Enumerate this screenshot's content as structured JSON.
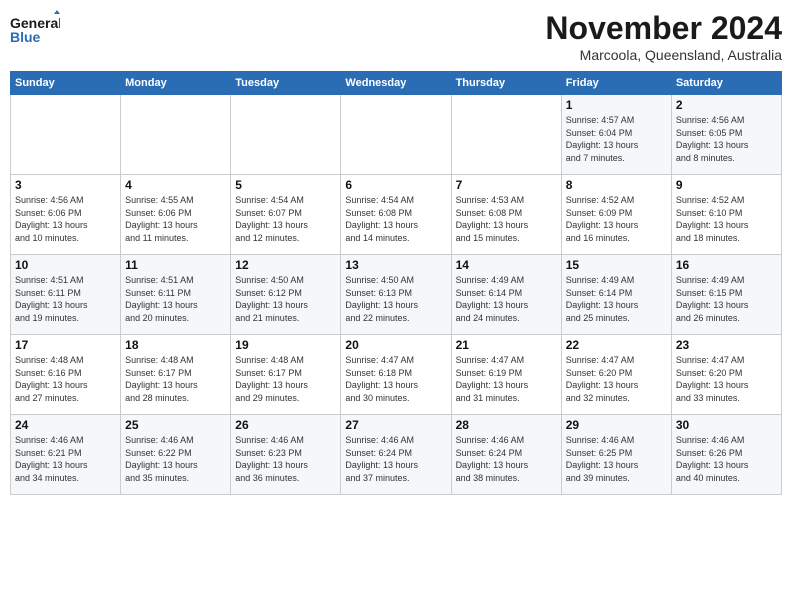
{
  "header": {
    "logo_line1": "General",
    "logo_line2": "Blue",
    "month": "November 2024",
    "location": "Marcoola, Queensland, Australia"
  },
  "weekdays": [
    "Sunday",
    "Monday",
    "Tuesday",
    "Wednesday",
    "Thursday",
    "Friday",
    "Saturday"
  ],
  "weeks": [
    [
      {
        "day": "",
        "info": ""
      },
      {
        "day": "",
        "info": ""
      },
      {
        "day": "",
        "info": ""
      },
      {
        "day": "",
        "info": ""
      },
      {
        "day": "",
        "info": ""
      },
      {
        "day": "1",
        "info": "Sunrise: 4:57 AM\nSunset: 6:04 PM\nDaylight: 13 hours\nand 7 minutes."
      },
      {
        "day": "2",
        "info": "Sunrise: 4:56 AM\nSunset: 6:05 PM\nDaylight: 13 hours\nand 8 minutes."
      }
    ],
    [
      {
        "day": "3",
        "info": "Sunrise: 4:56 AM\nSunset: 6:06 PM\nDaylight: 13 hours\nand 10 minutes."
      },
      {
        "day": "4",
        "info": "Sunrise: 4:55 AM\nSunset: 6:06 PM\nDaylight: 13 hours\nand 11 minutes."
      },
      {
        "day": "5",
        "info": "Sunrise: 4:54 AM\nSunset: 6:07 PM\nDaylight: 13 hours\nand 12 minutes."
      },
      {
        "day": "6",
        "info": "Sunrise: 4:54 AM\nSunset: 6:08 PM\nDaylight: 13 hours\nand 14 minutes."
      },
      {
        "day": "7",
        "info": "Sunrise: 4:53 AM\nSunset: 6:08 PM\nDaylight: 13 hours\nand 15 minutes."
      },
      {
        "day": "8",
        "info": "Sunrise: 4:52 AM\nSunset: 6:09 PM\nDaylight: 13 hours\nand 16 minutes."
      },
      {
        "day": "9",
        "info": "Sunrise: 4:52 AM\nSunset: 6:10 PM\nDaylight: 13 hours\nand 18 minutes."
      }
    ],
    [
      {
        "day": "10",
        "info": "Sunrise: 4:51 AM\nSunset: 6:11 PM\nDaylight: 13 hours\nand 19 minutes."
      },
      {
        "day": "11",
        "info": "Sunrise: 4:51 AM\nSunset: 6:11 PM\nDaylight: 13 hours\nand 20 minutes."
      },
      {
        "day": "12",
        "info": "Sunrise: 4:50 AM\nSunset: 6:12 PM\nDaylight: 13 hours\nand 21 minutes."
      },
      {
        "day": "13",
        "info": "Sunrise: 4:50 AM\nSunset: 6:13 PM\nDaylight: 13 hours\nand 22 minutes."
      },
      {
        "day": "14",
        "info": "Sunrise: 4:49 AM\nSunset: 6:14 PM\nDaylight: 13 hours\nand 24 minutes."
      },
      {
        "day": "15",
        "info": "Sunrise: 4:49 AM\nSunset: 6:14 PM\nDaylight: 13 hours\nand 25 minutes."
      },
      {
        "day": "16",
        "info": "Sunrise: 4:49 AM\nSunset: 6:15 PM\nDaylight: 13 hours\nand 26 minutes."
      }
    ],
    [
      {
        "day": "17",
        "info": "Sunrise: 4:48 AM\nSunset: 6:16 PM\nDaylight: 13 hours\nand 27 minutes."
      },
      {
        "day": "18",
        "info": "Sunrise: 4:48 AM\nSunset: 6:17 PM\nDaylight: 13 hours\nand 28 minutes."
      },
      {
        "day": "19",
        "info": "Sunrise: 4:48 AM\nSunset: 6:17 PM\nDaylight: 13 hours\nand 29 minutes."
      },
      {
        "day": "20",
        "info": "Sunrise: 4:47 AM\nSunset: 6:18 PM\nDaylight: 13 hours\nand 30 minutes."
      },
      {
        "day": "21",
        "info": "Sunrise: 4:47 AM\nSunset: 6:19 PM\nDaylight: 13 hours\nand 31 minutes."
      },
      {
        "day": "22",
        "info": "Sunrise: 4:47 AM\nSunset: 6:20 PM\nDaylight: 13 hours\nand 32 minutes."
      },
      {
        "day": "23",
        "info": "Sunrise: 4:47 AM\nSunset: 6:20 PM\nDaylight: 13 hours\nand 33 minutes."
      }
    ],
    [
      {
        "day": "24",
        "info": "Sunrise: 4:46 AM\nSunset: 6:21 PM\nDaylight: 13 hours\nand 34 minutes."
      },
      {
        "day": "25",
        "info": "Sunrise: 4:46 AM\nSunset: 6:22 PM\nDaylight: 13 hours\nand 35 minutes."
      },
      {
        "day": "26",
        "info": "Sunrise: 4:46 AM\nSunset: 6:23 PM\nDaylight: 13 hours\nand 36 minutes."
      },
      {
        "day": "27",
        "info": "Sunrise: 4:46 AM\nSunset: 6:24 PM\nDaylight: 13 hours\nand 37 minutes."
      },
      {
        "day": "28",
        "info": "Sunrise: 4:46 AM\nSunset: 6:24 PM\nDaylight: 13 hours\nand 38 minutes."
      },
      {
        "day": "29",
        "info": "Sunrise: 4:46 AM\nSunset: 6:25 PM\nDaylight: 13 hours\nand 39 minutes."
      },
      {
        "day": "30",
        "info": "Sunrise: 4:46 AM\nSunset: 6:26 PM\nDaylight: 13 hours\nand 40 minutes."
      }
    ]
  ]
}
